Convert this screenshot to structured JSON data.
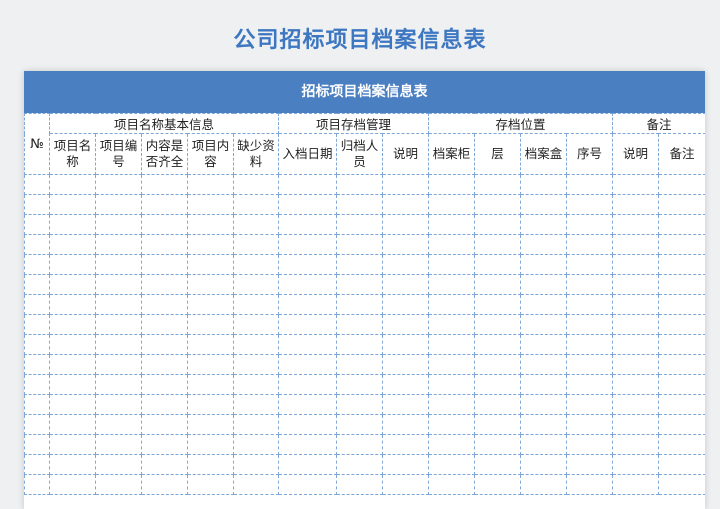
{
  "title": "公司招标项目档案信息表",
  "table_title": "招标项目档案信息表",
  "header": {
    "no": "№",
    "groups": [
      "项目名称基本信息",
      "项目存档管理",
      "存档位置",
      "备注"
    ],
    "columns": [
      "项目名称",
      "项目编号",
      "内容是否齐全",
      "项目内容",
      "缺少资料",
      "入档日期",
      "归档人员",
      "说明",
      "档案柜",
      "层",
      "档案盒",
      "序号",
      "说明",
      "备注"
    ]
  },
  "row_count": 16
}
